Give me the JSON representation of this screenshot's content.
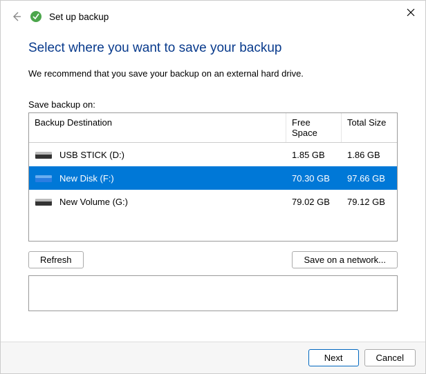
{
  "window": {
    "setup_label": "Set up backup"
  },
  "title": "Select where you want to save your backup",
  "recommend": "We recommend that you save your backup on an external hard drive.",
  "save_on_label": "Save backup on:",
  "table": {
    "headers": {
      "destination": "Backup Destination",
      "free": "Free Space",
      "total": "Total Size"
    },
    "rows": [
      {
        "name": "USB STICK (D:)",
        "free": "1.85 GB",
        "total": "1.86 GB",
        "selected": false,
        "icon": "dark"
      },
      {
        "name": "New Disk (F:)",
        "free": "70.30 GB",
        "total": "97.66 GB",
        "selected": true,
        "icon": "blue"
      },
      {
        "name": "New Volume (G:)",
        "free": "79.02 GB",
        "total": "79.12 GB",
        "selected": false,
        "icon": "dark"
      }
    ]
  },
  "buttons": {
    "refresh": "Refresh",
    "save_network": "Save on a network...",
    "next": "Next",
    "cancel": "Cancel"
  }
}
